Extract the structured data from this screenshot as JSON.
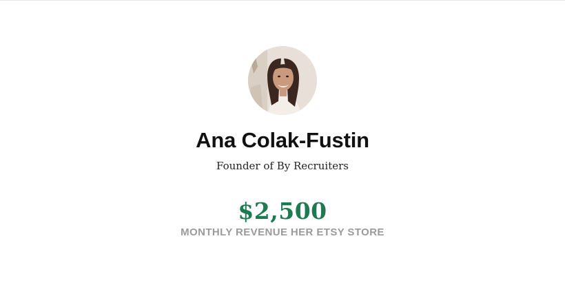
{
  "profile": {
    "avatar_icon": "person-photo-avatar",
    "name": "Ana Colak-Fustin",
    "role": "Founder of By Recruiters"
  },
  "stat": {
    "value": "$2,500",
    "label": "MONTHLY REVENUE HER ETSY STORE"
  },
  "colors": {
    "accent": "#1f7a52",
    "caption": "#9a9a9a",
    "name": "#111111"
  }
}
